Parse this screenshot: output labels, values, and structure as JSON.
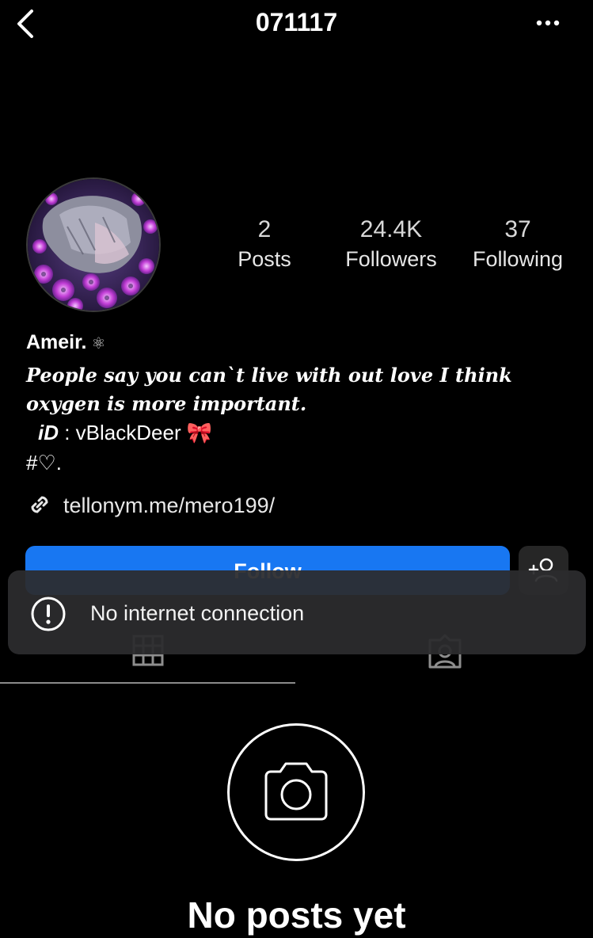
{
  "header": {
    "title": "071117",
    "back_icon": "chevron-left-icon",
    "more_icon": "more-horizontal-icon"
  },
  "profile": {
    "avatar_icon": "profile-avatar",
    "stats": [
      {
        "value": "2",
        "label": "Posts"
      },
      {
        "value": "24.4K",
        "label": "Followers"
      },
      {
        "value": "37",
        "label": "Following"
      }
    ],
    "name": "Ameir.",
    "name_symbol": "⚛",
    "bio_quote": "People say you can`t live with out love I think oxygen is more important.",
    "bio_id_label": "iD",
    "bio_id_sep": " : ",
    "bio_id_value": "vBlackDeer",
    "bio_id_emoji": "🎀",
    "bio_hash": "#♡.",
    "link": "tellonym.me/mero199/"
  },
  "actions": {
    "follow_label": "Follow",
    "add_user_icon": "add-user-icon",
    "follow_color": "#1877f2"
  },
  "tabs": [
    {
      "icon": "grid-icon",
      "active": true
    },
    {
      "icon": "tagged-icon",
      "active": false
    }
  ],
  "toast": {
    "icon": "alert-circle-icon",
    "text": "No internet connection"
  },
  "empty_state": {
    "icon": "camera-icon",
    "title": "No posts yet"
  }
}
